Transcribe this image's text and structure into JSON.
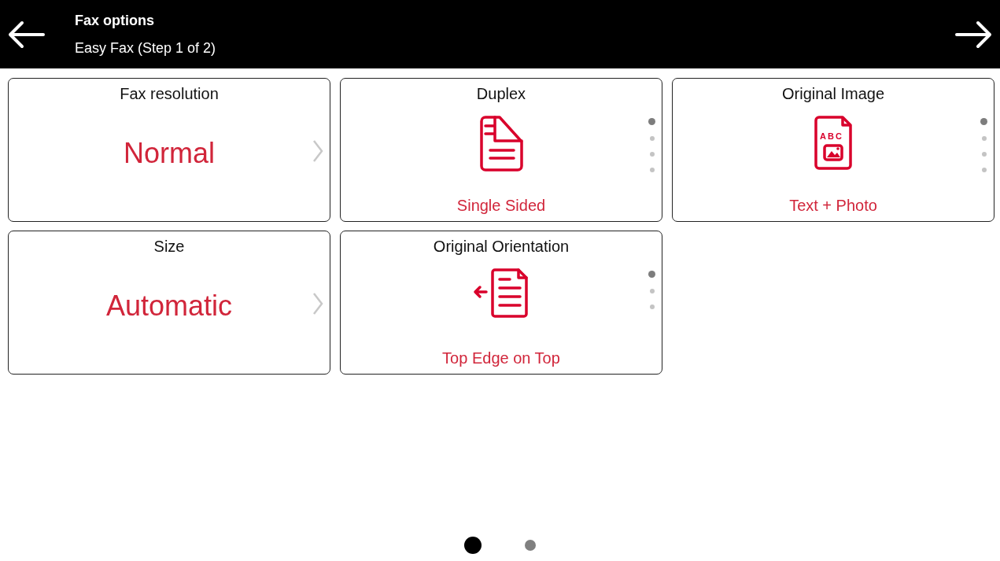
{
  "header": {
    "title": "Fax options",
    "subtitle": "Easy Fax (Step 1 of 2)"
  },
  "tiles": [
    {
      "kind": "value",
      "title": "Fax resolution",
      "value": "Normal"
    },
    {
      "kind": "duplex",
      "title": "Duplex",
      "value": "Single Sided",
      "dots": [
        {
          "selected": true
        },
        {
          "selected": false
        },
        {
          "selected": false
        },
        {
          "selected": false
        }
      ]
    },
    {
      "kind": "image",
      "title": "Original Image",
      "icon_label": "ABC",
      "value": "Text + Photo",
      "dots": [
        {
          "selected": true
        },
        {
          "selected": false
        },
        {
          "selected": false
        },
        {
          "selected": false
        }
      ]
    },
    {
      "kind": "value",
      "title": "Size",
      "value": "Automatic"
    },
    {
      "kind": "orientation",
      "title": "Original Orientation",
      "value": "Top Edge on Top",
      "dots": [
        {
          "selected": true
        },
        {
          "selected": false
        },
        {
          "selected": false
        }
      ]
    }
  ],
  "pages": [
    {
      "selected": true
    },
    {
      "selected": false
    }
  ]
}
